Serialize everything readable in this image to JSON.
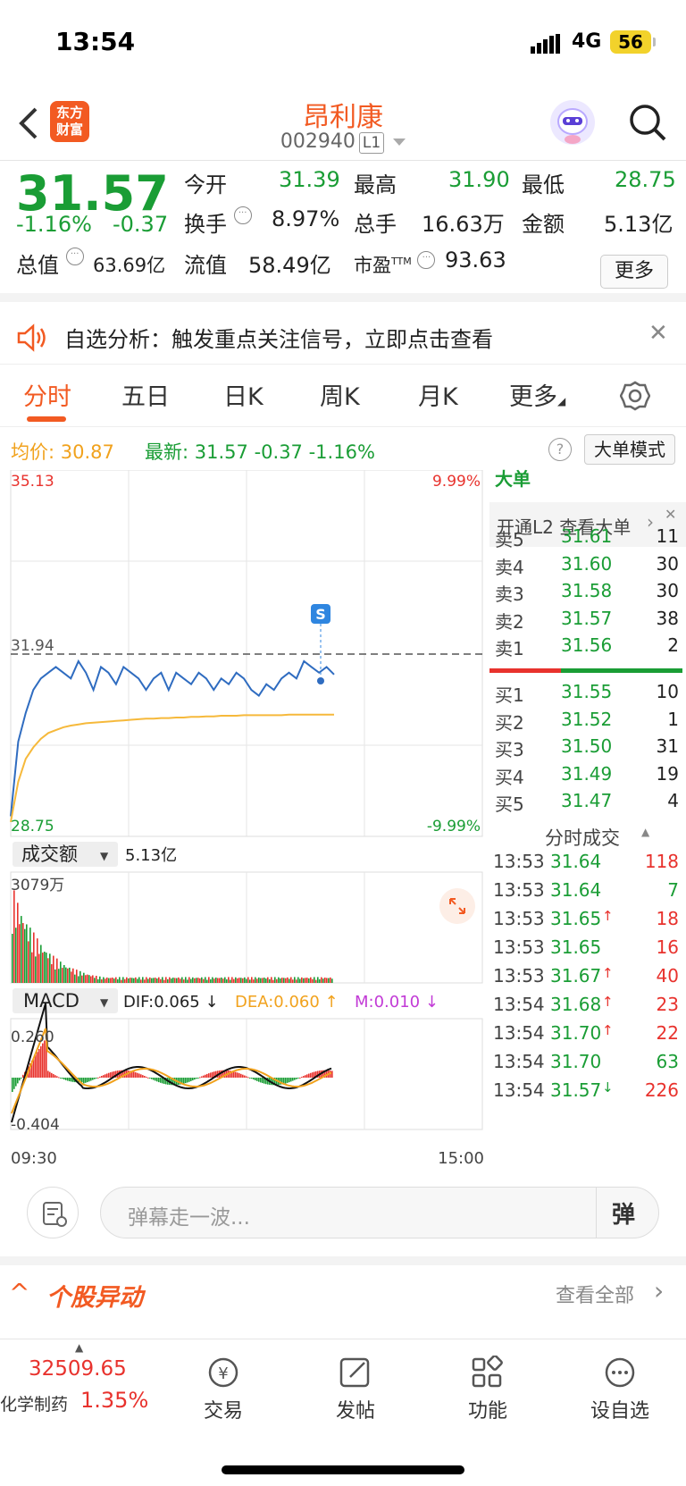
{
  "status": {
    "time": "13:54",
    "network": "4G",
    "battery": "56"
  },
  "header": {
    "logo_text": "东方财富",
    "stock_name": "昂利康",
    "stock_code": "002940",
    "level": "L1"
  },
  "quote": {
    "price": "31.57",
    "pct": "-1.16%",
    "chg": "-0.37",
    "open_label": "今开",
    "open": "31.39",
    "high_label": "最高",
    "high": "31.90",
    "low_label": "最低",
    "low": "28.75",
    "turnover_label": "换手",
    "turnover": "8.97%",
    "volume_label": "总手",
    "volume": "16.63万",
    "amount_label": "金额",
    "amount": "5.13亿",
    "mcap_label": "总值",
    "mcap": "63.69亿",
    "float_label": "流值",
    "float": "58.49亿",
    "pe_label": "市盈",
    "pe_tm": "TTM",
    "pe": "93.63",
    "more": "更多"
  },
  "alert": {
    "text": "自选分析：触发重点关注信号，立即点击查看"
  },
  "tabs": [
    "分时",
    "五日",
    "日K",
    "周K",
    "月K",
    "更多"
  ],
  "info": {
    "avg_label": "均价:",
    "avg": "30.87",
    "last_label": "最新:",
    "last": "31.57",
    "chg": "-0.37",
    "pct": "-1.16%",
    "big_order_mode": "大单模式"
  },
  "chart": {
    "top_price": "35.13",
    "top_pct": "9.99%",
    "ref_price": "31.94",
    "bottom_price": "28.75",
    "bottom_pct": "-9.99%",
    "s_marker": "S",
    "vol_label": "成交额",
    "vol_total": "5.13亿",
    "vol_max": "3079万",
    "macd_label": "MACD",
    "dif": "DIF:0.065 ↓",
    "dea": "DEA:0.060 ↑",
    "m": "M:0.010 ↓",
    "macd_top": "0.260",
    "macd_bottom": "-0.404",
    "time_start": "09:30",
    "time_end": "15:00"
  },
  "orderbook": {
    "big_title": "大单",
    "l2_text": "开通L2 查看大单",
    "asks": [
      {
        "label": "卖5",
        "price": "31.61",
        "vol": "11"
      },
      {
        "label": "卖4",
        "price": "31.60",
        "vol": "30"
      },
      {
        "label": "卖3",
        "price": "31.58",
        "vol": "30"
      },
      {
        "label": "卖2",
        "price": "31.57",
        "vol": "38"
      },
      {
        "label": "卖1",
        "price": "31.56",
        "vol": "2"
      }
    ],
    "bids": [
      {
        "label": "买1",
        "price": "31.55",
        "vol": "10"
      },
      {
        "label": "买2",
        "price": "31.52",
        "vol": "1"
      },
      {
        "label": "买3",
        "price": "31.50",
        "vol": "31"
      },
      {
        "label": "买4",
        "price": "31.49",
        "vol": "19"
      },
      {
        "label": "买5",
        "price": "31.47",
        "vol": "4"
      }
    ]
  },
  "ticks": {
    "title": "分时成交",
    "rows": [
      {
        "time": "13:53",
        "price": "31.64",
        "arrow": "",
        "vol": "118",
        "vc": "red"
      },
      {
        "time": "13:53",
        "price": "31.64",
        "arrow": "",
        "vol": "7",
        "vc": "green"
      },
      {
        "time": "13:53",
        "price": "31.65",
        "arrow": "↑",
        "vol": "18",
        "vc": "red"
      },
      {
        "time": "13:53",
        "price": "31.65",
        "arrow": "",
        "vol": "16",
        "vc": "red"
      },
      {
        "time": "13:53",
        "price": "31.67",
        "arrow": "↑",
        "vol": "40",
        "vc": "red"
      },
      {
        "time": "13:54",
        "price": "31.68",
        "arrow": "↑",
        "vol": "23",
        "vc": "red"
      },
      {
        "time": "13:54",
        "price": "31.70",
        "arrow": "↑",
        "vol": "22",
        "vc": "red"
      },
      {
        "time": "13:54",
        "price": "31.70",
        "arrow": "",
        "vol": "63",
        "vc": "green"
      },
      {
        "time": "13:54",
        "price": "31.57",
        "arrow": "↓",
        "vol": "226",
        "vc": "red"
      }
    ]
  },
  "bottom": {
    "placeholder": "弹幕走一波...",
    "danmu_btn": "弹",
    "section_title": "个股异动",
    "view_all": "查看全部"
  },
  "nav": {
    "index_value": "32509.65",
    "index_name": "化学制药",
    "index_pct": "1.35%",
    "trade": "交易",
    "post": "发帖",
    "func": "功能",
    "watch": "设自选"
  },
  "chart_data": {
    "type": "line",
    "title": "",
    "x_ticks": [
      "09:30",
      "15:00"
    ],
    "ylim": [
      28.75,
      35.13
    ],
    "reference": 31.94,
    "series": [
      {
        "name": "",
        "color": "#2f6cc0",
        "values": [
          29.1,
          30.4,
          30.9,
          31.3,
          31.5,
          31.6,
          31.7,
          31.6,
          31.5,
          31.8,
          31.6,
          31.3,
          31.7,
          31.6,
          31.4,
          31.7,
          31.6,
          31.5,
          31.3,
          31.5,
          31.6,
          31.3,
          31.6,
          31.5,
          31.4,
          31.6,
          31.5,
          31.3,
          31.5,
          31.4,
          31.6,
          31.5,
          31.3,
          31.2,
          31.4,
          31.3,
          31.5,
          31.6,
          31.5,
          31.8,
          31.7,
          31.6,
          31.7,
          31.57
        ]
      },
      {
        "name": "均价",
        "color": "#f6b93b",
        "values": [
          29.0,
          29.7,
          30.1,
          30.3,
          30.45,
          30.55,
          30.6,
          30.65,
          30.68,
          30.7,
          30.72,
          30.73,
          30.74,
          30.75,
          30.76,
          30.77,
          30.78,
          30.79,
          30.8,
          30.8,
          30.81,
          30.81,
          30.82,
          30.82,
          30.83,
          30.83,
          30.84,
          30.84,
          30.85,
          30.85,
          30.85,
          30.86,
          30.86,
          30.86,
          30.86,
          30.86,
          30.86,
          30.87,
          30.87,
          30.87,
          30.87,
          30.87,
          30.87,
          30.87
        ]
      }
    ]
  }
}
